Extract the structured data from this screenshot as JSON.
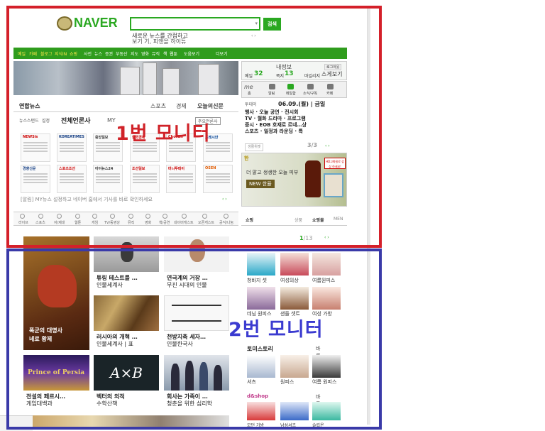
{
  "logo": {
    "text": "NAVER"
  },
  "search": {
    "button_label": "검색",
    "ticker": [
      "새로운 뉴스를 간접하고",
      "보기 기, 피앤을 하이튜"
    ]
  },
  "gnav": {
    "items": [
      "메일",
      "카페",
      "블로그",
      "지식iN",
      "쇼핑",
      "사전",
      "뉴스",
      "증권",
      "부동산",
      "지도",
      "영화",
      "뮤직",
      "책",
      "웹툰",
      "도움보기",
      "더보기"
    ]
  },
  "news": {
    "tab_main": "연합뉴스",
    "nav_right": [
      "스포츠",
      "경제",
      "오늘의신문"
    ],
    "tab_row": [
      "뉴스스탠드",
      "설정",
      "전체언론사",
      "MY"
    ],
    "badge": "주요언론사"
  },
  "papers": [
    "NEWSis",
    "KOREATIMES",
    "중앙일보",
    "한국경제",
    "Chosun",
    "프레시안",
    "경향신문",
    "스포츠조선",
    "아이뉴스24",
    "조선일보",
    "머니투데이",
    "OSEN"
  ],
  "alert": "[알림] MY뉴스 설정하고 네이버 홈에서 기사를 바로 확인하세요",
  "login": {
    "mail_label": "메일",
    "mail_count": "32",
    "note_label": "쪽지",
    "note_count": "13",
    "blog_label": "마일리지",
    "cash": "스게보기",
    "top": "내정보",
    "top2": "로그아웃"
  },
  "me_tabs": [
    "홈",
    "알림",
    "메일함",
    "소식/구독",
    "카페"
  ],
  "rt": {
    "header": "투데이",
    "date": "06.09.(월) | 금일",
    "lines": [
      "행사 · 오늘 공연 · 전시회",
      "TV · 월화 드라마 · 프로그램",
      "증시 · EOB 호재로 르네…상",
      "스포츠 · 일정과 라운딩 · 특"
    ],
    "more": "생활위젯",
    "page": "3/3"
  },
  "ad": {
    "headline": "더 맑고 생생한 오늘 피부",
    "brand": "NEW 한율 ",
    "tag": "HD고화질로 감상 하세요!"
  },
  "services": [
    "라이프",
    "스포츠",
    "자/제대",
    "웹툰",
    "게임",
    "TV/동영상",
    "뮤직",
    "영화",
    "책/공연",
    "네이버캐스트",
    "오픈캐스트",
    "공익/나눔"
  ],
  "shop": {
    "label": "쇼핑",
    "tabs": [
      "상품",
      "쇼핑몰",
      "MEN"
    ]
  },
  "pager": {
    "current": "1",
    "total": "/13"
  },
  "annotations": {
    "monitor1": "1번 모니터",
    "monitor2": "2번 모니터"
  },
  "cast": [
    {
      "title": "폭군의 대명사",
      "title2": "네로 황제",
      "sub": ""
    },
    {
      "title": "튜링 테스트를 …",
      "title2": "",
      "sub": "인물세계사"
    },
    {
      "title": "연극계의 거장 …",
      "title2": "",
      "sub": "무진 시대의 인물"
    },
    {
      "title": "러시아의 개혁 …",
      "title2": "",
      "sub": "인물세계사 | 표"
    },
    {
      "title": "천방지축 세자…",
      "title2": "",
      "sub": "인물한국사"
    },
    {
      "title": "전설의 페르시…",
      "title2": "",
      "sub": "게임대백과"
    },
    {
      "title": "벡터의 외적",
      "title2": "",
      "sub": "수학산책"
    },
    {
      "title": "회사는 가족이 …",
      "title2": "",
      "sub": "청춘을 위한 심리학"
    }
  ],
  "shop_right": {
    "sec1": "토미스토리",
    "sec1_more": "바로가기",
    "sec2": "d&shop",
    "sec2_more": "바로가기",
    "labels": [
      "청바지 셋",
      "여성의상",
      "여름원피스",
      "데님 원피스",
      "샌들 셋트",
      "여성 가방",
      "셔츠",
      "원피스",
      "여름 원피스",
      "모던 가방",
      "남성셔츠",
      "슬립온"
    ]
  },
  "colors": {
    "frame1": "#d4202a",
    "frame2": "#3a3aa8",
    "naver_green": "#2aa821"
  }
}
